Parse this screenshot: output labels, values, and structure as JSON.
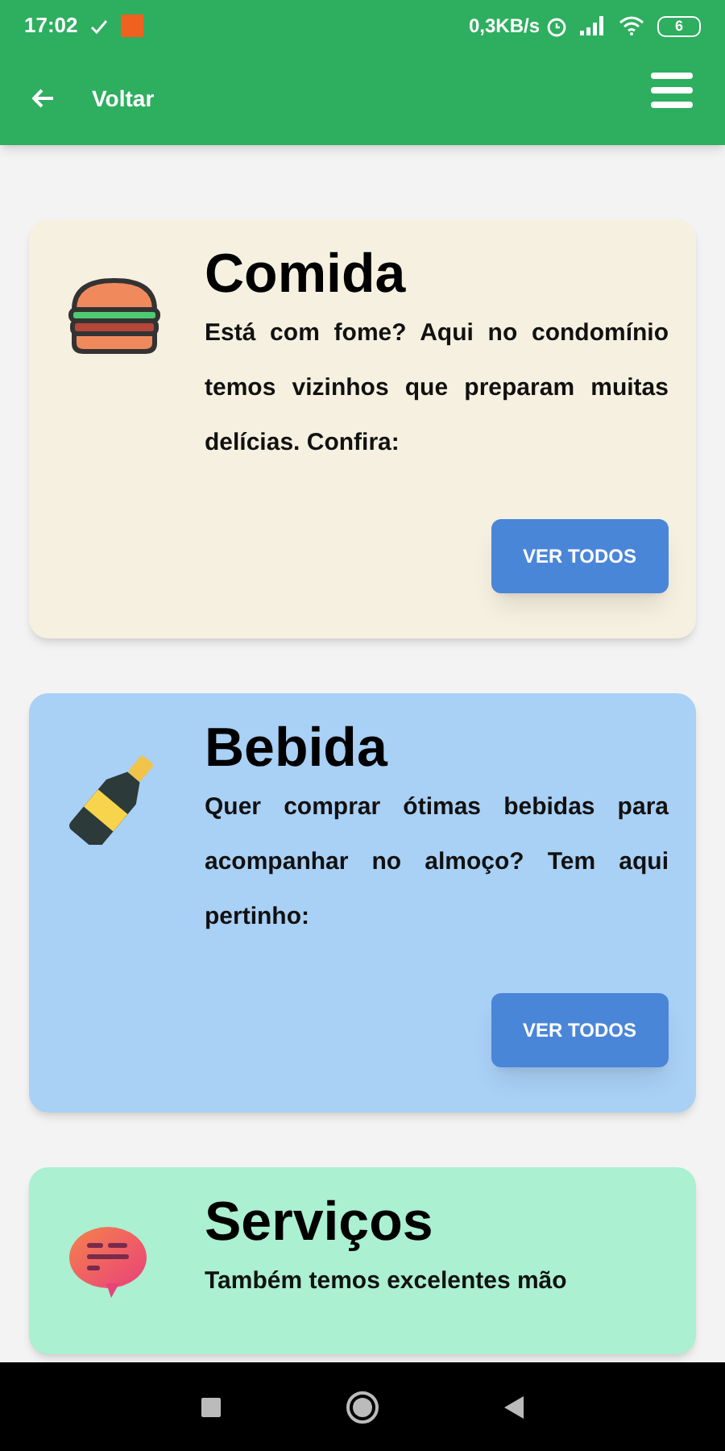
{
  "status_bar": {
    "time": "17:02",
    "speed": "0,3KB/s",
    "battery": "6"
  },
  "app_bar": {
    "back_label": "Voltar"
  },
  "cards": [
    {
      "kind": "burger",
      "color": "#f6f0e0",
      "title": "Comida",
      "description": "Está com fome? Aqui no condomínio temos vizinhos que preparam muitas delícias. Confira:",
      "button": "VER TODOS"
    },
    {
      "kind": "bottle",
      "color": "#a9d0f5",
      "title": "Bebida",
      "description": "Quer comprar ótimas bebidas para acompanhar no almoço? Tem aqui pertinho:",
      "button": "VER TODOS"
    },
    {
      "kind": "chat",
      "color": "#aaf0d1",
      "title": "Serviços",
      "description": "Também temos excelentes mão"
    }
  ]
}
